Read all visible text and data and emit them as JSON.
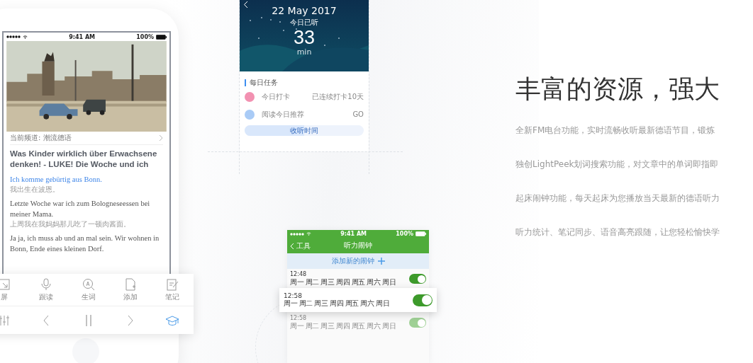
{
  "reader_phone": {
    "status_bar": {
      "time": "9:41 AM",
      "battery": "100%"
    },
    "channel": "当前频道: 潮流德语",
    "article_title": "Was Kinder wirklich über Erwachsene denken! - LUKE! Die Woche und ich",
    "paragraphs": [
      {
        "de": "Ich komme gebürtig aus Bonn.",
        "zh": "我出生在波恩。",
        "highlighted": true
      },
      {
        "de": "Letzte Woche war ich zum Bologneseessen bei meiner Mama.",
        "zh": "上周我在我妈妈那儿吃了一顿肉酱面。",
        "highlighted": false
      },
      {
        "de": "Ja ja, ich muss ab und an mal sein. Wir wohnen in Bonn, Ende eines kleinen Dorf.",
        "highlighted": false
      }
    ],
    "tools": [
      {
        "label": "屏"
      },
      {
        "label": "跟读"
      },
      {
        "label": "生词"
      },
      {
        "label": "添加"
      },
      {
        "label": "笔记"
      }
    ],
    "nav": [
      {
        "selected": false
      },
      {
        "selected": false
      },
      {
        "selected": false
      },
      {
        "selected": false
      },
      {
        "selected": true
      }
    ]
  },
  "stats_phone": {
    "date": "22 May 2017",
    "label": "今日已听",
    "minutes": "33",
    "unit": "min",
    "section_title": "每日任务",
    "tasks": [
      {
        "name": "今日打卡",
        "status": "已连续打卡10天",
        "color": "#f291b1"
      },
      {
        "name": "阅读今日推荐",
        "status": "GO",
        "color": "#a9cbf6"
      }
    ],
    "progress": {
      "label": "收听时间",
      "level": 0.5
    }
  },
  "alarm_phone": {
    "status_bar": {
      "time": "9:41 AM",
      "battery": "100%"
    },
    "back": "工具",
    "title": "听力闹钟",
    "add_label": "添加新的闹钟",
    "alarms": [
      {
        "time": "12:48",
        "days": "周一 周二 周三 周四 周五 周六 周日",
        "on": true,
        "kind": "row"
      },
      {
        "time": "12:58",
        "days": "周一 周二 周三 周四 周五 周六 周日",
        "on": true,
        "kind": "raised"
      },
      {
        "time": "12:58",
        "days": "周一 周二 周三 周四 周五 周六 周日",
        "on": true,
        "kind": "faded"
      }
    ]
  },
  "feature": {
    "heading": "丰富的资源，强大",
    "lines": [
      "全新FM电台功能，实时流畅收听最新德语节目，锻炼",
      "独创LightPeek划词搜索功能，对文章中的单词即指即",
      "起床闹钟功能，每天起床为您播放当天最新的德语听力",
      "听力统计、笔记同步、语音高亮跟随，让您轻松愉快学"
    ]
  }
}
